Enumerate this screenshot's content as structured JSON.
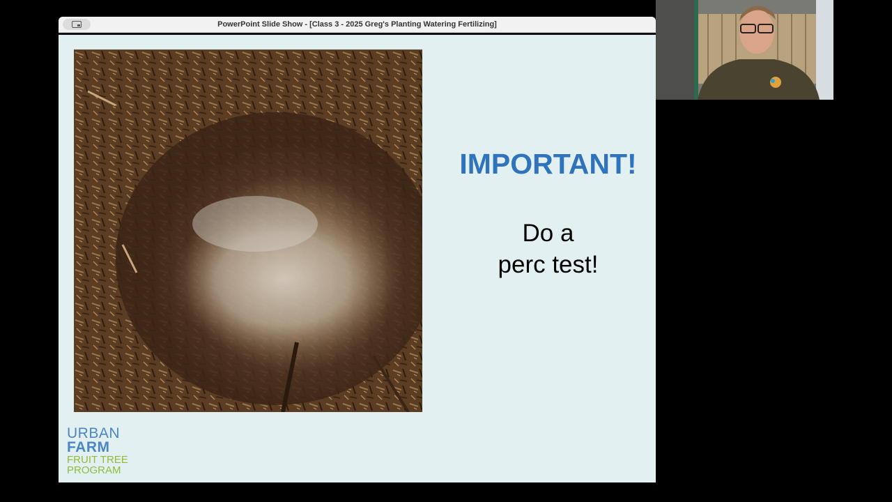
{
  "window": {
    "title": "PowerPoint Slide Show - [Class 3 - 2025 Greg's Planting Watering Fertilizing]"
  },
  "slide": {
    "headline": "IMPORTANT!",
    "body_lines": [
      "Do a",
      "perc test!"
    ],
    "logo": {
      "line1": "URBAN",
      "line2": "FARM",
      "line3": "FRUIT TREE",
      "line4": "PROGRAM"
    }
  },
  "colors": {
    "slide_background": "#e3f0f1",
    "headline": "#2f73bd",
    "logo_blue": "#4a86c4",
    "logo_green": "#8dbd3e"
  },
  "icons": {
    "titlebar_button": "presenter-view-icon"
  }
}
